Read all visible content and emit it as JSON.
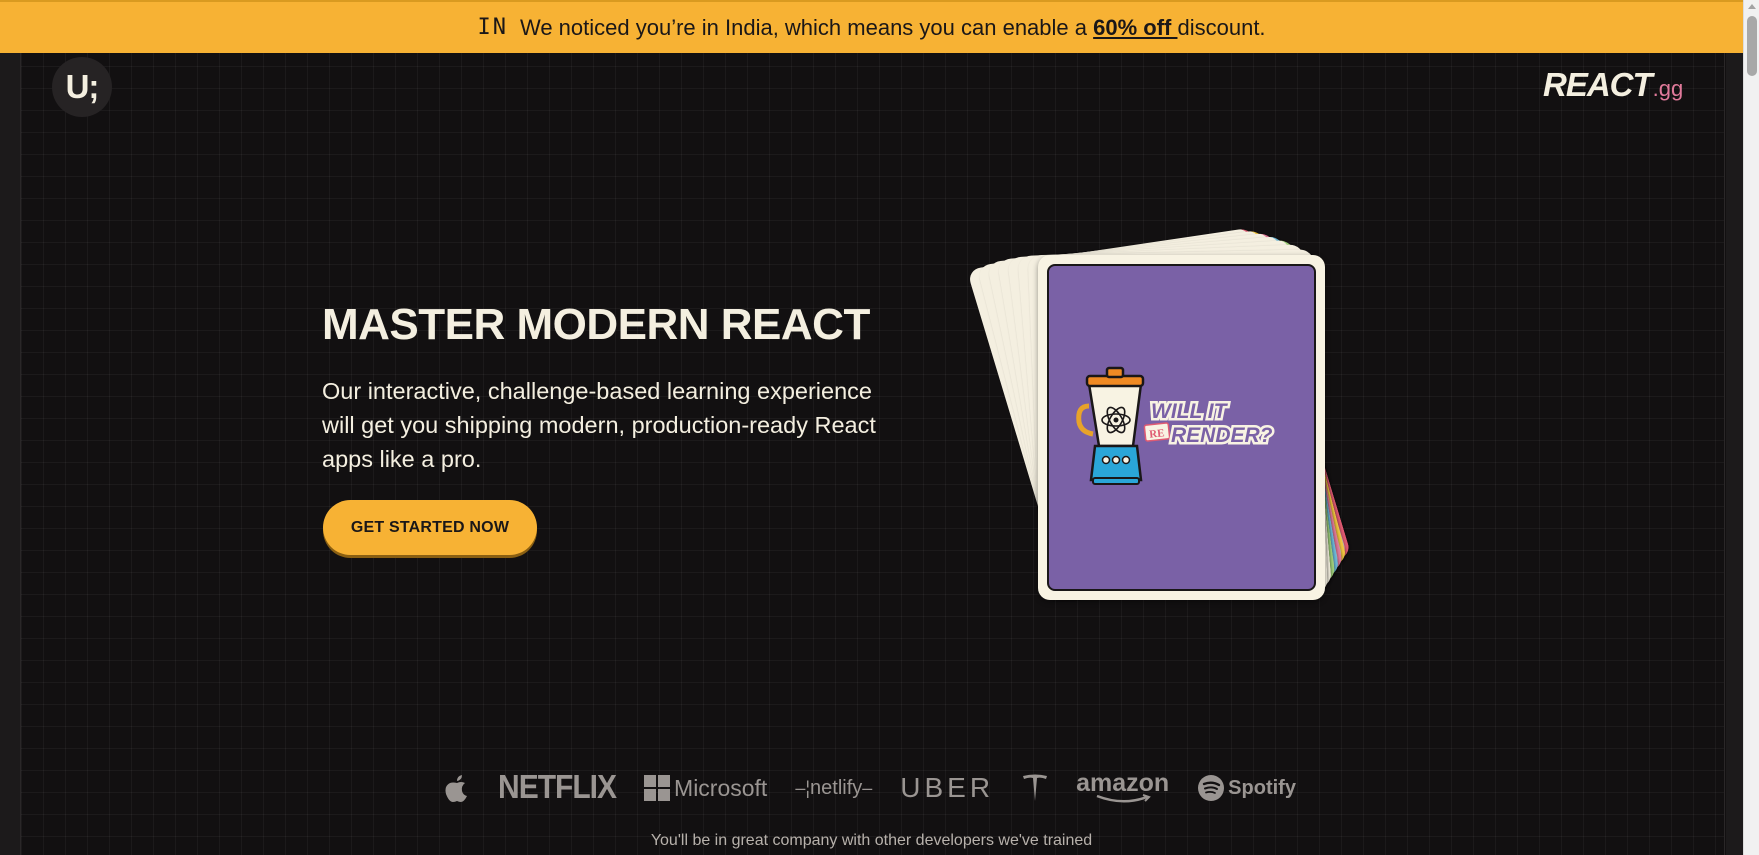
{
  "banner": {
    "flag": "IN",
    "message_before": "We noticed you’re in India, which means you can enable a ",
    "offer": "60% off ",
    "message_after": "discount."
  },
  "header": {
    "ui_logo": "U;",
    "react_logo": "REACT",
    "react_logo_suffix": ".gg"
  },
  "hero": {
    "title": "MASTER MODERN REACT",
    "description": "Our interactive, challenge-based learning experience will get you shipping modern, production-ready React apps like a pro.",
    "cta": "GET STARTED NOW",
    "card": {
      "line1": "WILL IT",
      "badge": "RE",
      "line2": "RENDER?",
      "card_color": "#7a61a6",
      "stack_edge_colors": [
        "#e05a72",
        "#f0c540",
        "#e0799a",
        "#6cb8d8",
        "#9fcf7a",
        "#f4efe0",
        "#f4efe0"
      ]
    }
  },
  "companies": {
    "apple": "apple-icon",
    "netflix": "NETFLIX",
    "microsoft": "Microsoft",
    "netlify": "netlify",
    "uber": "UBER",
    "tesla": "tesla-icon",
    "amazon": "amazon",
    "spotify": "Spotify",
    "tagline": "You'll be in great company with other developers we've trained"
  },
  "colors": {
    "accent": "#f7b234",
    "background": "#121011",
    "text": "#f4efe0",
    "react_gg": "#e0799a"
  }
}
